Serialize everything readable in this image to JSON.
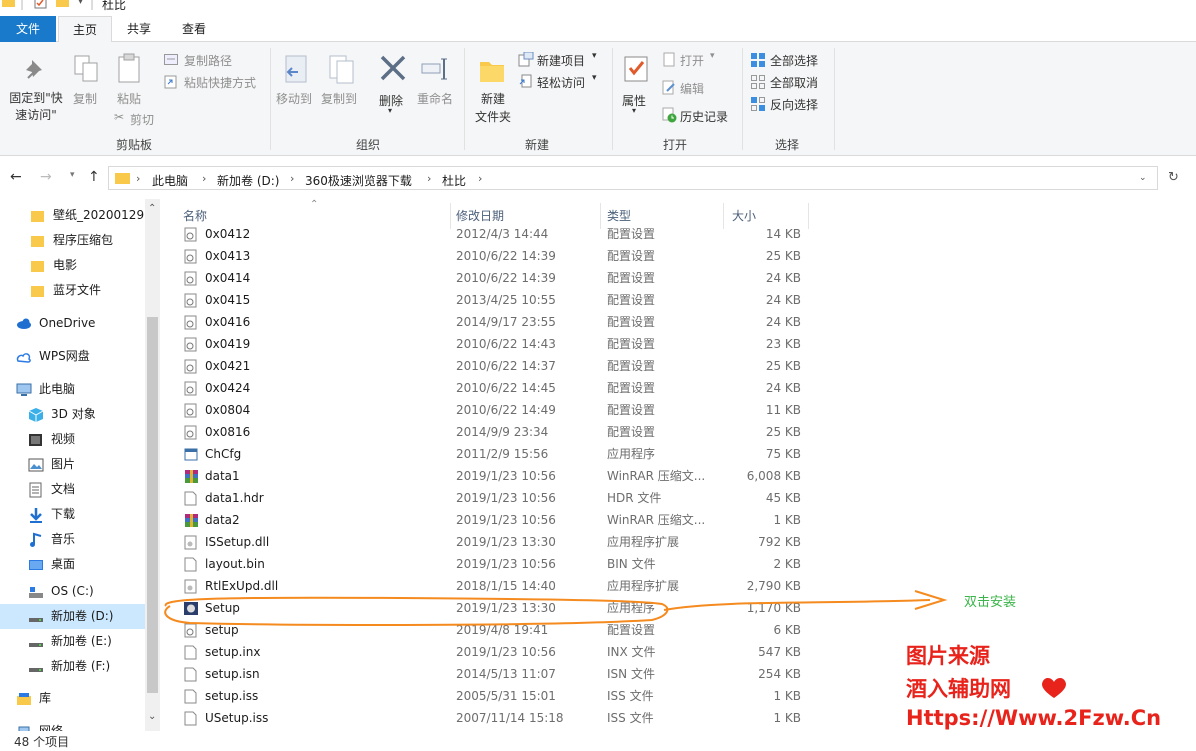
{
  "title_bar": {
    "folder_name": "杜比"
  },
  "ribbon_tabs": [
    "文件",
    "主页",
    "共享",
    "查看"
  ],
  "ribbon": {
    "clipboard": {
      "pin": "固定到\"快速访问\"",
      "copy": "复制",
      "paste": "粘贴",
      "copy_path": "复制路径",
      "paste_shortcut": "粘贴快捷方式",
      "cut": "剪切",
      "label": "剪贴板"
    },
    "organize": {
      "move_to": "移动到",
      "copy_to": "复制到",
      "delete": "删除",
      "rename": "重命名",
      "label": "组织"
    },
    "new": {
      "new_folder": "新建\n文件夹",
      "new_item": "新建项目",
      "easy_access": "轻松访问",
      "label": "新建"
    },
    "open": {
      "properties": "属性",
      "open": "打开",
      "edit": "编辑",
      "history": "历史记录",
      "label": "打开"
    },
    "select": {
      "select_all": "全部选择",
      "select_none": "全部取消",
      "invert": "反向选择",
      "label": "选择"
    }
  },
  "breadcrumb": [
    "此电脑",
    "新加卷 (D:)",
    "360极速浏览器下载",
    "杜比"
  ],
  "nav": [
    {
      "label": "壁纸_20200129",
      "icon": "folder-icon"
    },
    {
      "label": "程序压缩包",
      "icon": "folder-icon"
    },
    {
      "label": "电影",
      "icon": "folder-icon"
    },
    {
      "label": "蓝牙文件",
      "icon": "folder-icon"
    },
    {
      "label": "OneDrive",
      "icon": "cloud-icon"
    },
    {
      "label": "WPS网盘",
      "icon": "wps-cloud-icon"
    },
    {
      "label": "此电脑",
      "icon": "computer-icon"
    },
    {
      "label": "3D 对象",
      "icon": "cube-icon"
    },
    {
      "label": "视频",
      "icon": "video-icon"
    },
    {
      "label": "图片",
      "icon": "picture-icon"
    },
    {
      "label": "文档",
      "icon": "document-icon"
    },
    {
      "label": "下载",
      "icon": "download-icon"
    },
    {
      "label": "音乐",
      "icon": "music-icon"
    },
    {
      "label": "桌面",
      "icon": "desktop-icon"
    },
    {
      "label": "OS (C:)",
      "icon": "drive-c-icon"
    },
    {
      "label": "新加卷 (D:)",
      "icon": "drive-icon"
    },
    {
      "label": "新加卷 (E:)",
      "icon": "drive-icon"
    },
    {
      "label": "新加卷 (F:)",
      "icon": "drive-icon"
    },
    {
      "label": "库",
      "icon": "library-icon"
    },
    {
      "label": "网络",
      "icon": "network-icon"
    }
  ],
  "columns": {
    "name": "名称",
    "date": "修改日期",
    "type": "类型",
    "size": "大小"
  },
  "files": [
    {
      "name": "0x0412",
      "date": "2012/4/3 14:44",
      "type": "配置设置",
      "size": "14 KB",
      "icon": "ini-icon"
    },
    {
      "name": "0x0413",
      "date": "2010/6/22 14:39",
      "type": "配置设置",
      "size": "25 KB",
      "icon": "ini-icon"
    },
    {
      "name": "0x0414",
      "date": "2010/6/22 14:39",
      "type": "配置设置",
      "size": "24 KB",
      "icon": "ini-icon"
    },
    {
      "name": "0x0415",
      "date": "2013/4/25 10:55",
      "type": "配置设置",
      "size": "24 KB",
      "icon": "ini-icon"
    },
    {
      "name": "0x0416",
      "date": "2014/9/17 23:55",
      "type": "配置设置",
      "size": "24 KB",
      "icon": "ini-icon"
    },
    {
      "name": "0x0419",
      "date": "2010/6/22 14:43",
      "type": "配置设置",
      "size": "23 KB",
      "icon": "ini-icon"
    },
    {
      "name": "0x0421",
      "date": "2010/6/22 14:37",
      "type": "配置设置",
      "size": "25 KB",
      "icon": "ini-icon"
    },
    {
      "name": "0x0424",
      "date": "2010/6/22 14:45",
      "type": "配置设置",
      "size": "24 KB",
      "icon": "ini-icon"
    },
    {
      "name": "0x0804",
      "date": "2010/6/22 14:49",
      "type": "配置设置",
      "size": "11 KB",
      "icon": "ini-icon"
    },
    {
      "name": "0x0816",
      "date": "2014/9/9 23:34",
      "type": "配置设置",
      "size": "25 KB",
      "icon": "ini-icon"
    },
    {
      "name": "ChCfg",
      "date": "2011/2/9 15:56",
      "type": "应用程序",
      "size": "75 KB",
      "icon": "exe-icon"
    },
    {
      "name": "data1",
      "date": "2019/1/23 10:56",
      "type": "WinRAR 压缩文...",
      "size": "6,008 KB",
      "icon": "winrar-icon"
    },
    {
      "name": "data1.hdr",
      "date": "2019/1/23 10:56",
      "type": "HDR 文件",
      "size": "45 KB",
      "icon": "file-icon"
    },
    {
      "name": "data2",
      "date": "2019/1/23 10:56",
      "type": "WinRAR 压缩文...",
      "size": "1 KB",
      "icon": "winrar-icon"
    },
    {
      "name": "ISSetup.dll",
      "date": "2019/1/23 13:30",
      "type": "应用程序扩展",
      "size": "792 KB",
      "icon": "dll-icon"
    },
    {
      "name": "layout.bin",
      "date": "2019/1/23 10:56",
      "type": "BIN 文件",
      "size": "2 KB",
      "icon": "file-icon"
    },
    {
      "name": "RtlExUpd.dll",
      "date": "2018/1/15 14:40",
      "type": "应用程序扩展",
      "size": "2,790 KB",
      "icon": "dll-icon"
    },
    {
      "name": "Setup",
      "date": "2019/1/23 13:30",
      "type": "应用程序",
      "size": "1,170 KB",
      "icon": "setup-icon"
    },
    {
      "name": "setup",
      "date": "2019/4/8 19:41",
      "type": "配置设置",
      "size": "6 KB",
      "icon": "ini-icon"
    },
    {
      "name": "setup.inx",
      "date": "2019/1/23 10:56",
      "type": "INX 文件",
      "size": "547 KB",
      "icon": "file-icon"
    },
    {
      "name": "setup.isn",
      "date": "2014/5/13 11:07",
      "type": "ISN 文件",
      "size": "254 KB",
      "icon": "file-icon"
    },
    {
      "name": "setup.iss",
      "date": "2005/5/31 15:01",
      "type": "ISS 文件",
      "size": "1 KB",
      "icon": "file-icon"
    },
    {
      "name": "USetup.iss",
      "date": "2007/11/14 15:18",
      "type": "ISS 文件",
      "size": "1 KB",
      "icon": "file-icon"
    }
  ],
  "status": "48 个项目",
  "annotation": "双击安装",
  "watermark": [
    "图片来源",
    "酒入辅助网",
    "Https://Www.2Fzw.Cn"
  ],
  "colors": {
    "file_tab": "#1979ca",
    "selection": "#cce8ff",
    "annotation_line": "#f58a1f",
    "annotation_text": "#3bb54a",
    "watermark": "#e8231b"
  }
}
